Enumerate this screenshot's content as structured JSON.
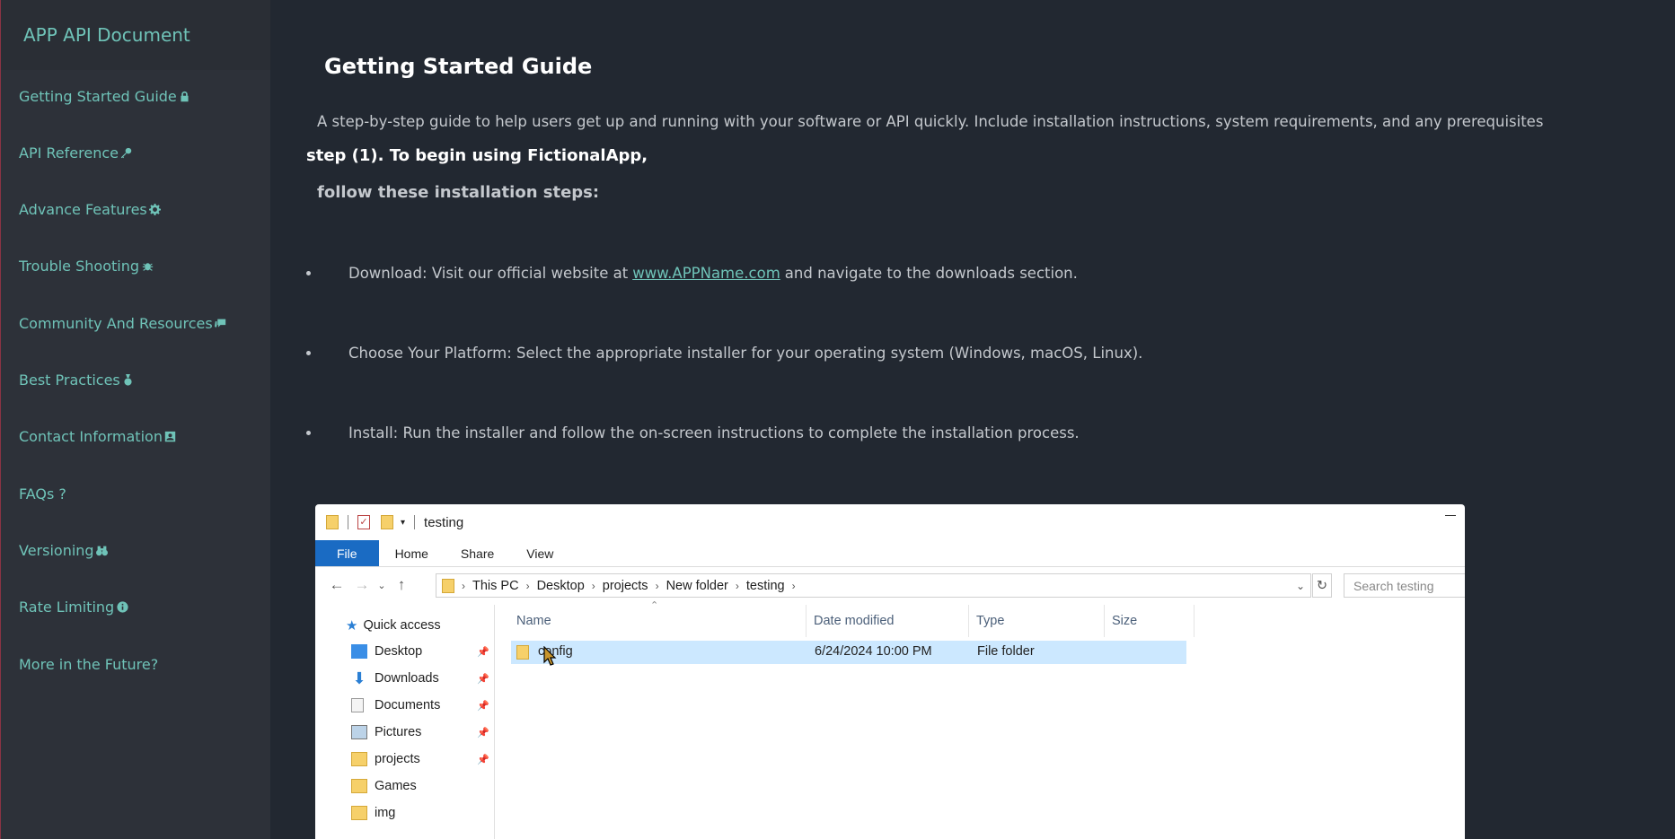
{
  "brand": "APP API Document",
  "nav": [
    {
      "label": "Getting Started Guide",
      "icon": "lock-icon"
    },
    {
      "label": "API Reference",
      "icon": "key-icon"
    },
    {
      "label": "Advance Features",
      "icon": "gear-icon"
    },
    {
      "label": "Trouble Shooting",
      "icon": "bug-icon"
    },
    {
      "label": "Community And Resources",
      "icon": "chat-icon"
    },
    {
      "label": "Best Practices",
      "icon": "medal-icon"
    },
    {
      "label": "Contact Information",
      "icon": "contact-card-icon"
    },
    {
      "label": "FAQs ?",
      "icon": ""
    },
    {
      "label": "Versioning",
      "icon": "binoculars-icon"
    },
    {
      "label": "Rate Limiting",
      "icon": "info-icon"
    },
    {
      "label": "More in the Future?",
      "icon": ""
    }
  ],
  "main": {
    "title": "Getting Started Guide",
    "intro": "A step-by-step guide to help users get up and running with your software or API quickly. Include installation instructions, system requirements, and any prerequisites",
    "step_heading": "step (1). To begin using FictionalApp,",
    "step_subheading": "follow these installation steps:",
    "bullets": {
      "b1_pre": "Download: Visit our official website at",
      "b1_link": "www.APPName.com",
      "b1_post": "and navigate to the downloads section.",
      "b2": "Choose Your Platform: Select the appropriate installer for your operating system (Windows, macOS, Linux).",
      "b3": "Install: Run the installer and follow the on-screen instructions to complete the installation process."
    }
  },
  "explorer": {
    "window_title": "testing",
    "ribbon": [
      "File",
      "Home",
      "Share",
      "View"
    ],
    "breadcrumb": [
      "This PC",
      "Desktop",
      "projects",
      "New folder",
      "testing"
    ],
    "search_placeholder": "Search testing",
    "nav_pane": {
      "quick_access": "Quick access",
      "items": [
        "Desktop",
        "Downloads",
        "Documents",
        "Pictures",
        "projects",
        "Games",
        "img"
      ]
    },
    "columns": [
      "Name",
      "Date modified",
      "Type",
      "Size"
    ],
    "rows": [
      {
        "name": "config",
        "date": "6/24/2024 10:00 PM",
        "type": "File folder",
        "size": ""
      }
    ],
    "colors": {
      "file_tab": "#1a6bc3",
      "selected_row": "#cce8ff",
      "folder": "#f6d06a"
    }
  }
}
